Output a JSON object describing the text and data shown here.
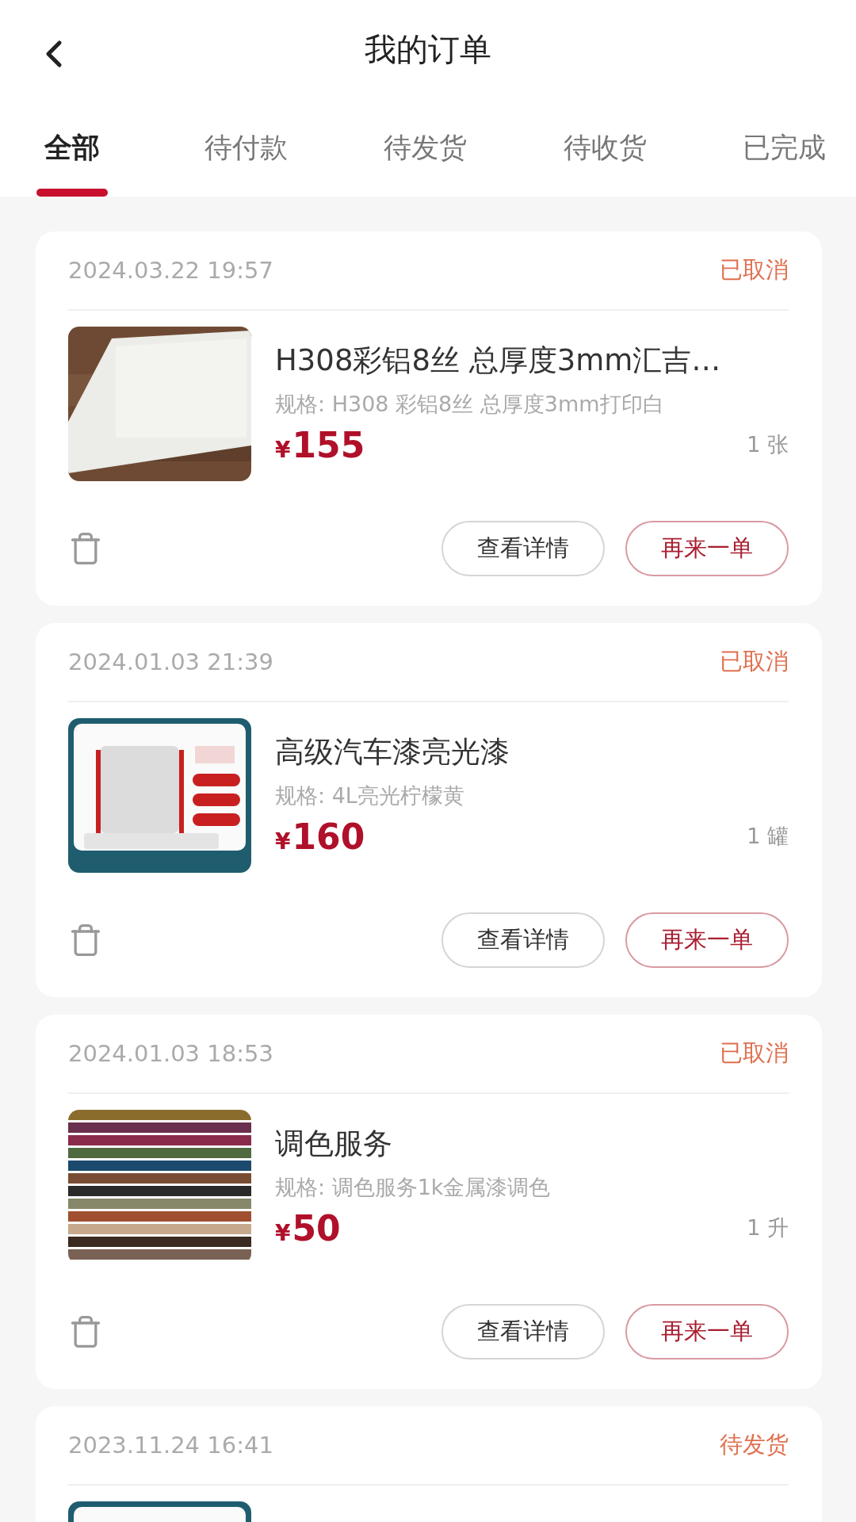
{
  "header": {
    "title": "我的订单"
  },
  "tabs": [
    {
      "label": "全部",
      "selected": true
    },
    {
      "label": "待付款",
      "selected": false
    },
    {
      "label": "待发货",
      "selected": false
    },
    {
      "label": "待收货",
      "selected": false
    },
    {
      "label": "已完成",
      "selected": false
    }
  ],
  "orders": [
    {
      "date": "2024.03.22 19:57",
      "status": "已取消",
      "title": "H308彩铝8丝 总厚度3mm汇吉…",
      "spec": "规格: H308 彩铝8丝 总厚度3mm打印白",
      "currency": "¥",
      "price": "155",
      "quantity": "1 张",
      "buttons": [
        {
          "label": "查看详情",
          "kind": "plain"
        },
        {
          "label": "再来一单",
          "kind": "accent"
        }
      ]
    },
    {
      "date": "2024.01.03 21:39",
      "status": "已取消",
      "title": "高级汽车漆亮光漆",
      "spec": "规格: 4L亮光柠檬黄",
      "currency": "¥",
      "price": "160",
      "quantity": "1 罐",
      "buttons": [
        {
          "label": "查看详情",
          "kind": "plain"
        },
        {
          "label": "再来一单",
          "kind": "accent"
        }
      ]
    },
    {
      "date": "2024.01.03 18:53",
      "status": "已取消",
      "title": "调色服务",
      "spec": "规格: 调色服务1k金属漆调色",
      "currency": "¥",
      "price": "50",
      "quantity": "1 升",
      "buttons": [
        {
          "label": "查看详情",
          "kind": "plain"
        },
        {
          "label": "再来一单",
          "kind": "accent"
        }
      ]
    },
    {
      "date": "2023.11.24 16:41",
      "status": "待发货"
    }
  ]
}
